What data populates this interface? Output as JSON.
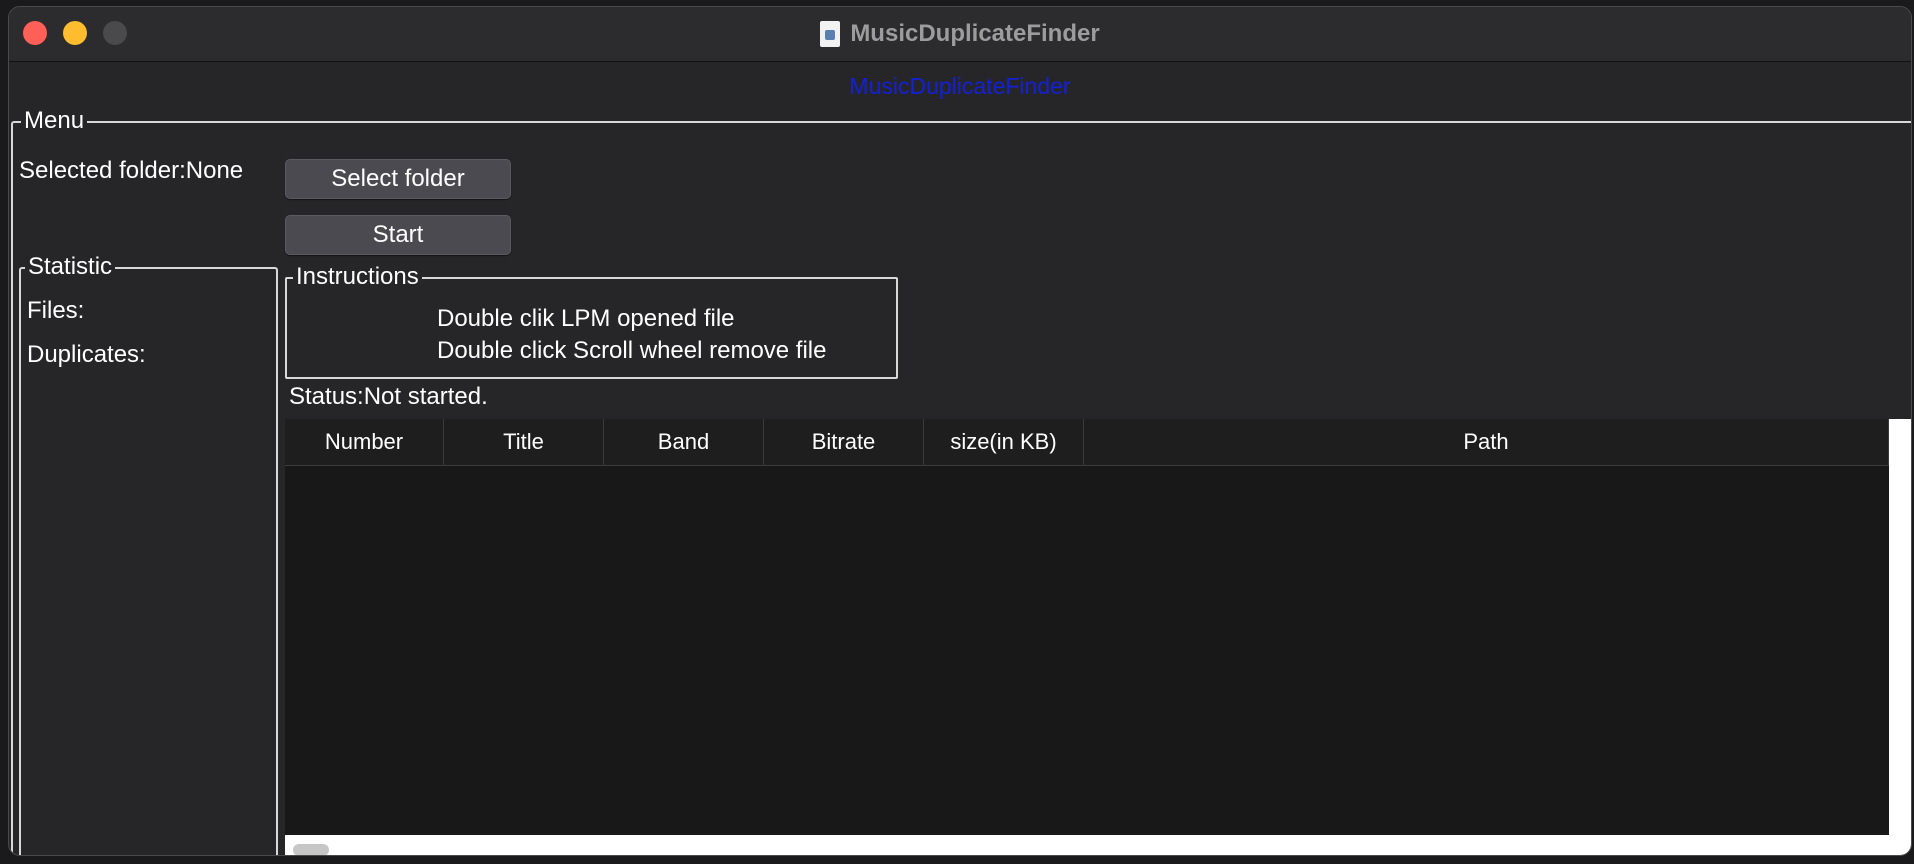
{
  "window": {
    "title": "MusicDuplicateFinder",
    "banner": "MusicDuplicateFinder",
    "banner_color": "#1420d8"
  },
  "menu": {
    "legend": "Menu",
    "selected_folder_label": "Selected folder:None",
    "select_folder_button": "Select folder",
    "start_button": "Start"
  },
  "statistic": {
    "legend": "Statistic",
    "files_label": "Files:",
    "duplicates_label": "Duplicates:"
  },
  "instructions": {
    "legend": "Instructions",
    "line1": "Double clik LPM opened file",
    "line2": "Double click Scroll wheel remove file"
  },
  "status": {
    "text": "Status:Not started."
  },
  "table": {
    "columns": [
      "Number",
      "Title",
      "Band",
      "Bitrate",
      "size(in KB)",
      "Path"
    ],
    "rows": []
  }
}
